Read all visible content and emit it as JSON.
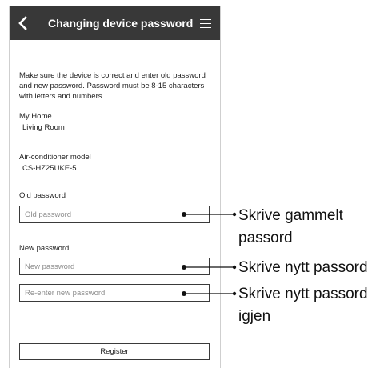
{
  "header": {
    "title": "Changing device password",
    "back_icon": "chevron-left-icon",
    "menu_icon": "hamburger-menu-icon",
    "background_color": "#383838"
  },
  "instructions": "Make sure the device is correct and enter old password and new password. Password must be 8-15 characters with letters and numbers.",
  "home": {
    "label": "My Home",
    "value": "Living Room"
  },
  "model": {
    "label": "Air-conditioner model",
    "value": "CS-HZ25UKE-5"
  },
  "old_password": {
    "label": "Old password",
    "placeholder": "Old password"
  },
  "new_password": {
    "label": "New password",
    "placeholder": "New password",
    "reenter_placeholder": "Re-enter new password"
  },
  "register_label": "Register",
  "callouts": {
    "old_line1": "Skrive gammelt",
    "old_line2": "passord",
    "new": "Skrive nytt passord",
    "reenter_line1": "Skrive nytt passord",
    "reenter_line2": "igjen"
  }
}
